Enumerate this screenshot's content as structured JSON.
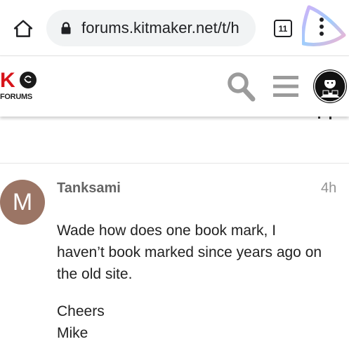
{
  "browser": {
    "url": "forums.kitmaker.net/t/h",
    "tab_count": "11"
  },
  "site": {
    "logo_letters": "K",
    "logo_subtitle": "FORUMS"
  },
  "post": {
    "avatar_letter": "M",
    "author": "Tanksami",
    "time": "4h",
    "body_lines": [
      "Wade how does one book mark, I",
      "haven’t book marked since years ago on",
      "the old site."
    ],
    "sign_lines": [
      "Cheers",
      "Mike"
    ]
  },
  "colors": {
    "avatar_bg": "#9b7565",
    "logo_red": "#d7141a",
    "assistant_gradient": [
      "#c8a2f5",
      "#8ec5fc",
      "#f5a3c7"
    ]
  },
  "icons": [
    "home-icon",
    "lock-icon",
    "tabs-icon",
    "more-vert-icon",
    "search-icon",
    "hamburger-icon"
  ]
}
